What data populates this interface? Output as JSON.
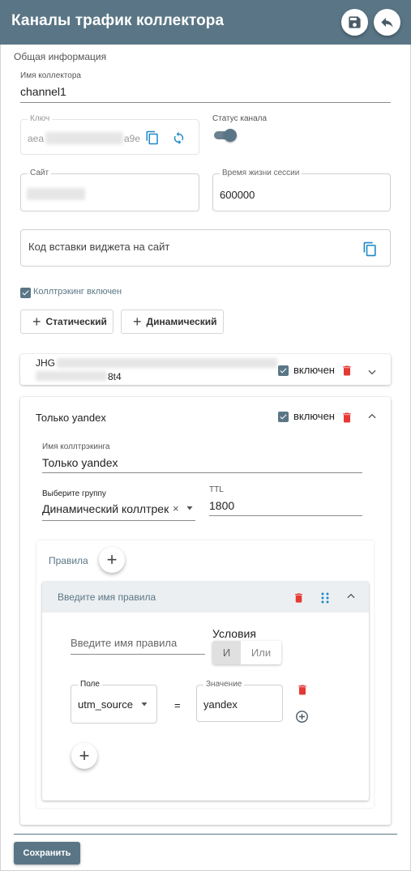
{
  "header": {
    "title": "Каналы трафик коллектора"
  },
  "general": {
    "section_label": "Общая информация",
    "collector_name": {
      "label": "Имя коллектора",
      "value": "channel1"
    },
    "key": {
      "label": "Ключ",
      "prefix": "aea",
      "suffix": "a9e"
    },
    "channel_status": {
      "label": "Статус канала",
      "enabled": true
    },
    "site": {
      "label": "Сайт"
    },
    "session_ttl": {
      "label": "Время жизни сессии",
      "value": "600000"
    },
    "widget_code": {
      "placeholder": "Код вставки виджета на сайт"
    }
  },
  "calltracking": {
    "enabled_label": "Коллтрэкинг включен",
    "add_static": "Статический",
    "add_dynamic": "Динамический",
    "channel1": {
      "title_start": "JHG",
      "title_end": "8t4",
      "enabled_label": "включен"
    },
    "channel2": {
      "title": "Только yandex",
      "enabled_label": "включен",
      "name_label": "Имя коллтрэкинга",
      "name_value": "Только yandex",
      "group_label": "Выберите группу",
      "group_value": "Динамический коллтрек…",
      "ttl_label": "TTL",
      "ttl_value": "1800"
    }
  },
  "rules": {
    "label": "Правила",
    "rule_header": "Введите имя правила",
    "rule_name_placeholder": "Введите имя правила",
    "conditions_label": "Условия",
    "and_label": "И",
    "or_label": "Или",
    "field_label": "Поле",
    "field_value": "utm_source",
    "equals": "=",
    "value_label": "Значение",
    "value_value": "yandex"
  },
  "footer": {
    "save_label": "Сохранить"
  },
  "colors": {
    "primary": "#5a7686",
    "danger": "#e53935",
    "accent_blue": "#1e88c8"
  }
}
